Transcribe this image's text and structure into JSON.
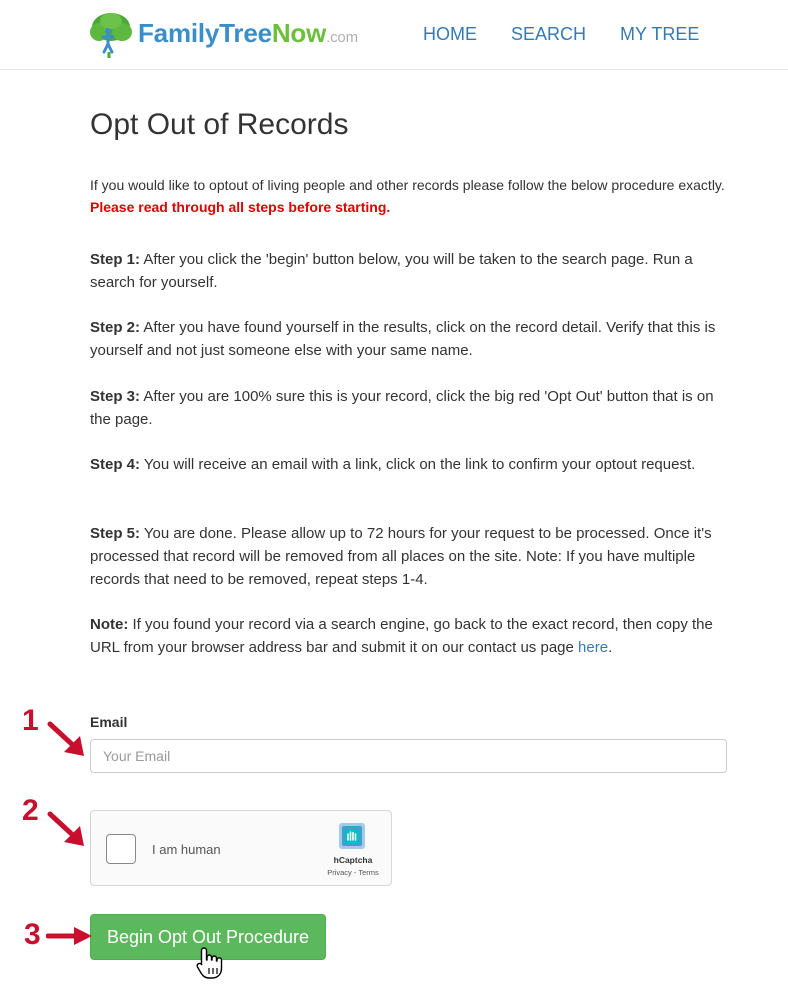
{
  "header": {
    "logo": {
      "part1": "FamilyTree",
      "part2": "Now",
      "part3": ".com"
    },
    "nav": [
      {
        "label": "HOME"
      },
      {
        "label": "SEARCH"
      },
      {
        "label": "MY TREE"
      }
    ]
  },
  "page": {
    "title": "Opt Out of Records",
    "intro": "If you would like to optout of living people and other records please follow the below procedure exactly.",
    "warning": "Please read through all steps before starting.",
    "steps": [
      {
        "label": "Step 1:",
        "text": "After you click the 'begin' button below, you will be taken to the search page. Run a search for yourself."
      },
      {
        "label": "Step 2:",
        "text": "After you have found yourself in the results, click on the record detail. Verify that this is yourself and not just someone else with your same name."
      },
      {
        "label": "Step 3:",
        "text": "After you are 100% sure this is your record, click the big red 'Opt Out' button that is on the page."
      },
      {
        "label": "Step 4:",
        "text": "You will receive an email with a link, click on the link to confirm your optout request."
      },
      {
        "label": "Step 5:",
        "text": "You are done. Please allow up to 72 hours for your request to be processed. Once it's processed that record will be removed from all places on the site. Note: If you have multiple records that need to be removed, repeat steps 1-4."
      }
    ],
    "note": {
      "label": "Note:",
      "text": "If you found your record via a search engine, go back to the exact record, then copy the URL from your browser address bar and submit it on our contact us page",
      "link_text": "here",
      "suffix": "."
    }
  },
  "form": {
    "email_label": "Email",
    "email_placeholder": "Your Email",
    "email_value": "",
    "captcha": {
      "label": "I am human",
      "brand": "hCaptcha",
      "links": "Privacy - Terms",
      "checked": false
    },
    "submit_label": "Begin Opt Out Procedure"
  },
  "annotations": {
    "markers": [
      "1",
      "2",
      "3"
    ],
    "color": "#c8102e"
  },
  "colors": {
    "link": "#337ab7",
    "warning": "#e00000",
    "button": "#5cb85c",
    "logo_blue": "#3a8fc9",
    "logo_green": "#6cbf3a"
  }
}
